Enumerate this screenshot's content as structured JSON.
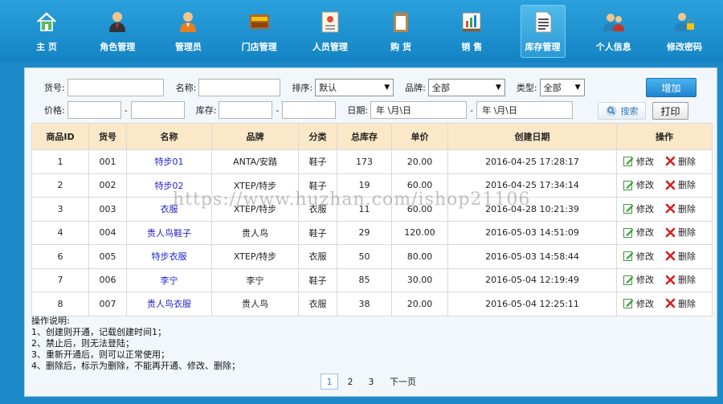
{
  "nav": {
    "items": [
      {
        "label": "主 页",
        "icon": "home-icon"
      },
      {
        "label": "角色管理",
        "icon": "role-icon"
      },
      {
        "label": "管理员",
        "icon": "admin-icon"
      },
      {
        "label": "门店管理",
        "icon": "store-icon"
      },
      {
        "label": "人员管理",
        "icon": "staff-icon"
      },
      {
        "label": "购 货",
        "icon": "purchase-icon"
      },
      {
        "label": "销 售",
        "icon": "sales-icon"
      },
      {
        "label": "库存管理",
        "icon": "inventory-icon",
        "active": true
      },
      {
        "label": "个人信息",
        "icon": "profile-icon"
      },
      {
        "label": "修改密码",
        "icon": "password-icon"
      }
    ]
  },
  "filters": {
    "code_label": "货号:",
    "name_label": "名称:",
    "sort_label": "排序:",
    "sort_value": "默认",
    "brand_label": "品牌:",
    "brand_value": "全部",
    "type_label": "类型:",
    "type_value": "全部",
    "price_label": "价格:",
    "stock_label": "库存:",
    "date_label": "日期:",
    "date_from_placeholder": "年 \\月\\日",
    "date_to_placeholder": "年 \\月\\日",
    "search_label": "搜索",
    "print_label": "打印",
    "add_label": "增加",
    "dash": "-"
  },
  "table": {
    "headers": [
      "商品ID",
      "货号",
      "名称",
      "品牌",
      "分类",
      "总库存",
      "单价",
      "创建日期",
      "操作"
    ],
    "edit_label": "修改",
    "delete_label": "删除",
    "rows": [
      {
        "id": "1",
        "code": "001",
        "name": "特步01",
        "brand": "ANTA/安踏",
        "category": "鞋子",
        "stock": "173",
        "price": "20.00",
        "created": "2016-04-25 17:28:17"
      },
      {
        "id": "2",
        "code": "002",
        "name": "特步02",
        "brand": "XTEP/特步",
        "category": "鞋子",
        "stock": "19",
        "price": "60.00",
        "created": "2016-04-25 17:34:14"
      },
      {
        "id": "3",
        "code": "003",
        "name": "衣服",
        "brand": "XTEP/特步",
        "category": "衣服",
        "stock": "11",
        "price": "60.00",
        "created": "2016-04-28 10:21:39"
      },
      {
        "id": "4",
        "code": "004",
        "name": "贵人鸟鞋子",
        "brand": "贵人鸟",
        "category": "鞋子",
        "stock": "29",
        "price": "120.00",
        "created": "2016-05-03 14:51:09"
      },
      {
        "id": "6",
        "code": "005",
        "name": "特步衣服",
        "brand": "XTEP/特步",
        "category": "衣服",
        "stock": "50",
        "price": "80.00",
        "created": "2016-05-03 14:58:44"
      },
      {
        "id": "7",
        "code": "006",
        "name": "李宁",
        "brand": "李宁",
        "category": "鞋子",
        "stock": "85",
        "price": "30.00",
        "created": "2016-05-04 12:19:49"
      },
      {
        "id": "8",
        "code": "007",
        "name": "贵人鸟衣服",
        "brand": "贵人鸟",
        "category": "衣服",
        "stock": "38",
        "price": "20.00",
        "created": "2016-05-04 12:25:11"
      }
    ]
  },
  "notes": {
    "title": "操作说明:",
    "lines": [
      "1、创建则开通，记载创建时间1；",
      "2、禁止后，则无法登陆；",
      "3、重新开通后，则可以正常使用；",
      "4、删除后，标示为删除，不能再开通、修改、删除；"
    ]
  },
  "pager": {
    "pages": [
      "1",
      "2",
      "3"
    ],
    "current": "1",
    "next_label": "下一页"
  },
  "watermark": "https://www.huzhan.com/ishop21106",
  "colors": {
    "nav_bg": "#1583c4",
    "header_bg": "#fbe8c9",
    "link": "#2222cc",
    "accent": "#1e84cf"
  }
}
